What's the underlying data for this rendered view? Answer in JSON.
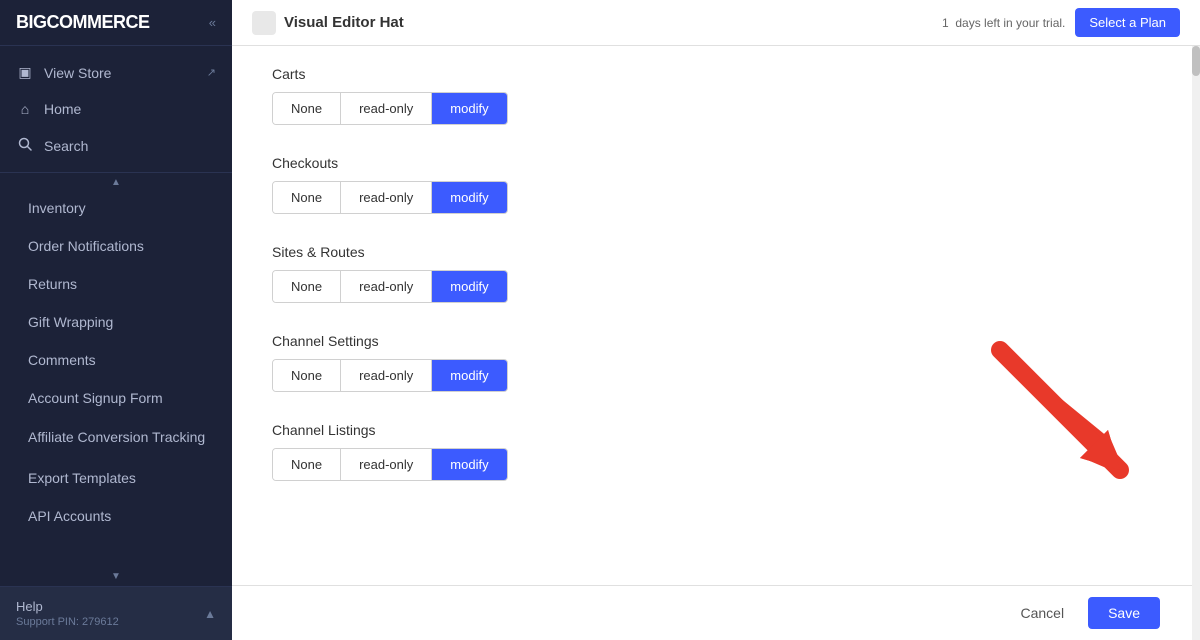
{
  "sidebar": {
    "logo": "BIGCOMMERCE",
    "collapse_icon": "«",
    "nav_items": [
      {
        "id": "view-store",
        "label": "View Store",
        "icon": "▣",
        "has_external": true
      },
      {
        "id": "home",
        "label": "Home",
        "icon": "⌂"
      },
      {
        "id": "search",
        "label": "Search",
        "icon": "🔍"
      }
    ],
    "menu_items": [
      {
        "id": "inventory",
        "label": "Inventory"
      },
      {
        "id": "order-notifications",
        "label": "Order Notifications"
      },
      {
        "id": "returns",
        "label": "Returns"
      },
      {
        "id": "gift-wrapping",
        "label": "Gift Wrapping"
      },
      {
        "id": "comments",
        "label": "Comments"
      },
      {
        "id": "account-signup-form",
        "label": "Account Signup Form"
      },
      {
        "id": "affiliate-conversion-tracking",
        "label": "Affiliate Conversion Tracking"
      },
      {
        "id": "export-templates",
        "label": "Export Templates"
      },
      {
        "id": "api-accounts",
        "label": "API Accounts"
      }
    ],
    "footer": {
      "label": "Help",
      "sub": "Support PIN: 279612",
      "chevron": "▲"
    }
  },
  "topbar": {
    "icon_placeholder": "",
    "title": "Visual Editor Hat",
    "trial_text": "days left in your trial.",
    "trial_days": "1",
    "select_plan_label": "Select a Plan"
  },
  "sections": [
    {
      "id": "carts",
      "label": "Carts",
      "options": [
        {
          "id": "none",
          "label": "None",
          "active": false
        },
        {
          "id": "read-only",
          "label": "read-only",
          "active": false
        },
        {
          "id": "modify",
          "label": "modify",
          "active": true
        }
      ]
    },
    {
      "id": "checkouts",
      "label": "Checkouts",
      "options": [
        {
          "id": "none",
          "label": "None",
          "active": false
        },
        {
          "id": "read-only",
          "label": "read-only",
          "active": false
        },
        {
          "id": "modify",
          "label": "modify",
          "active": true
        }
      ]
    },
    {
      "id": "sites-routes",
      "label": "Sites & Routes",
      "options": [
        {
          "id": "none",
          "label": "None",
          "active": false
        },
        {
          "id": "read-only",
          "label": "read-only",
          "active": false
        },
        {
          "id": "modify",
          "label": "modify",
          "active": true
        }
      ]
    },
    {
      "id": "channel-settings",
      "label": "Channel Settings",
      "options": [
        {
          "id": "none",
          "label": "None",
          "active": false
        },
        {
          "id": "read-only",
          "label": "read-only",
          "active": false
        },
        {
          "id": "modify",
          "label": "modify",
          "active": true
        }
      ]
    },
    {
      "id": "channel-listings",
      "label": "Channel Listings",
      "options": [
        {
          "id": "none",
          "label": "None",
          "active": false
        },
        {
          "id": "read-only",
          "label": "read-only",
          "active": false
        },
        {
          "id": "modify",
          "label": "modify",
          "active": true
        }
      ]
    }
  ],
  "bottom": {
    "cancel_label": "Cancel",
    "save_label": "Save"
  },
  "colors": {
    "active_btn": "#3c5bff",
    "arrow": "#e8392a"
  }
}
